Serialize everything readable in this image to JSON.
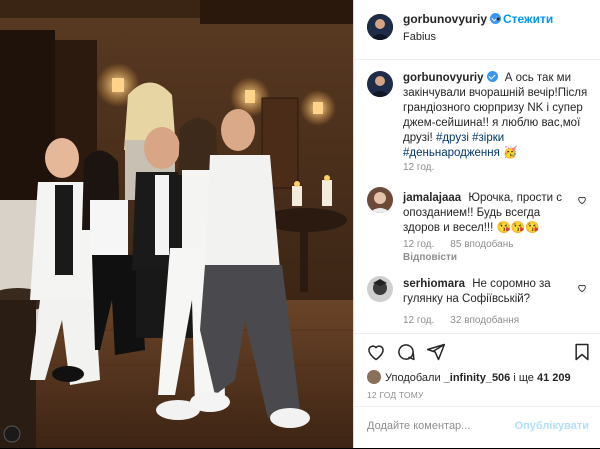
{
  "post": {
    "username": "gorbunovyuriy",
    "follow_label": "Стежити",
    "location": "Fabius",
    "dot": "•"
  },
  "caption": {
    "username": "gorbunovyuriy",
    "text": "А ось так ми закінчували вчорашній вечір!Після грандіозного сюрпризу NK і супер джем-сейшина!! я люблю вас,мої друзі!",
    "hashtags": [
      "#друзі",
      "#зірки",
      "#деньнародження"
    ],
    "emoji": "🥳",
    "time": "12 год."
  },
  "comments": [
    {
      "username": "jamalajaaa",
      "text": "Юрочка, прости с опозданием!! Будь всегда здоров и весел!!!",
      "emoji": "😘😘😘",
      "time": "12 год.",
      "likes": "85 вподобань",
      "reply": "Відповісти",
      "avatar_color": "#6b4a3a"
    },
    {
      "username": "serhiomara",
      "text": "Не соромно за гулянку на Софіївській?",
      "time": "12 год.",
      "likes": "32 вподобання",
      "avatar_color": "#4a4a4a"
    }
  ],
  "actions": {
    "like_icon": "heart-icon",
    "comment_icon": "comment-icon",
    "share_icon": "share-icon",
    "save_icon": "bookmark-icon"
  },
  "likes_line": {
    "prefix": "Уподобали",
    "user": "_infinity_506",
    "middle": " і ще ",
    "count": "41 209"
  },
  "timestamp": "12 ГОД ТОМУ",
  "add_comment": {
    "placeholder": "Додайте коментар...",
    "publish_label": "Опублікувати"
  },
  "colors": {
    "accent": "#0095f6",
    "verified": "#3897f0",
    "hashtag": "#00376b",
    "muted": "#8e8e8e"
  }
}
